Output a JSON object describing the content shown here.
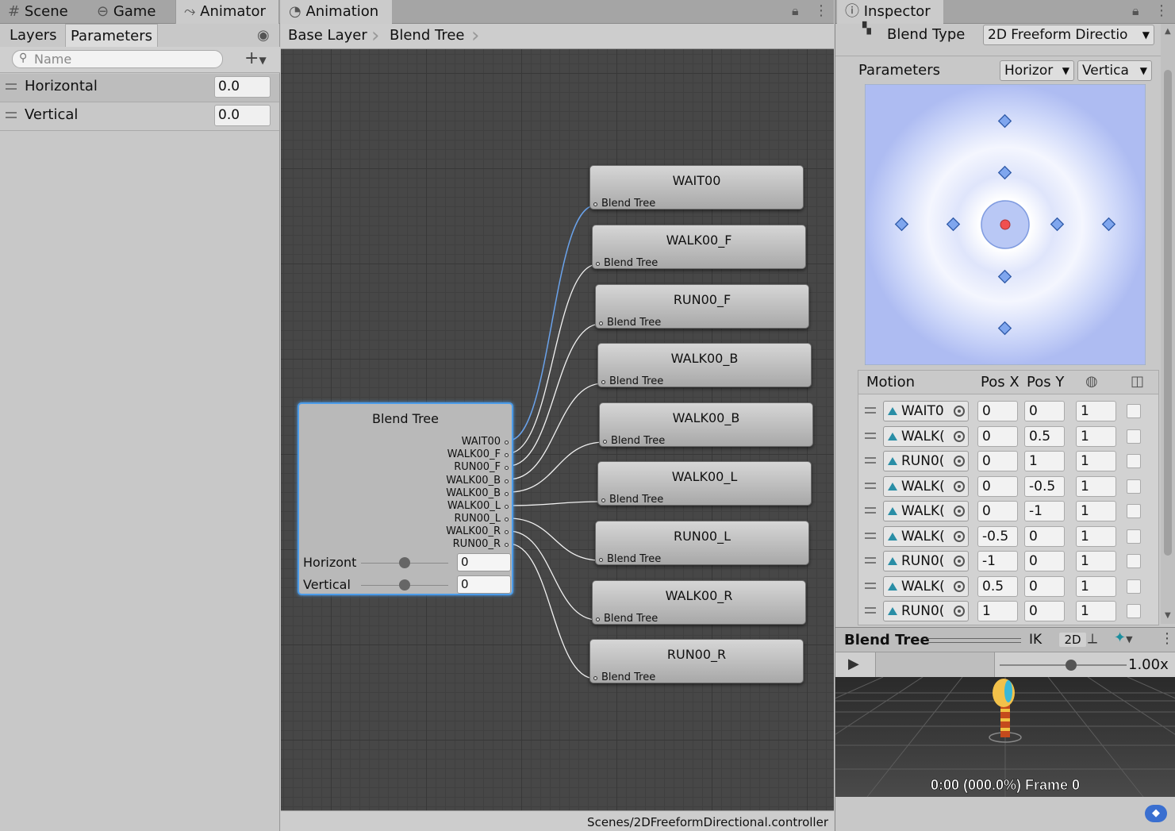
{
  "left_panel": {
    "tabs": [
      {
        "label": "Scene"
      },
      {
        "label": "Game"
      },
      {
        "label": "Animator"
      }
    ],
    "subtabs": {
      "layers": "Layers",
      "parameters": "Parameters"
    },
    "search_placeholder": "Name",
    "params": [
      {
        "name": "Horizontal",
        "value": "0.0"
      },
      {
        "name": "Vertical",
        "value": "0.0"
      }
    ]
  },
  "animation": {
    "tab": "Animation",
    "breadcrumb": [
      "Base Layer",
      "Blend Tree"
    ],
    "status_path": "Scenes/2DFreeformDirectional.controller",
    "blend_tree": {
      "title": "Blend Tree",
      "outputs": [
        "WAIT00",
        "WALK00_F",
        "RUN00_F",
        "WALK00_B",
        "WALK00_B",
        "WALK00_L",
        "RUN00_L",
        "WALK00_R",
        "RUN00_R"
      ],
      "params": [
        {
          "name": "Horizonta",
          "value": "0"
        },
        {
          "name": "Vertical",
          "value": "0"
        }
      ]
    },
    "nodes": [
      {
        "title": "WAIT00",
        "sub": "Blend Tree"
      },
      {
        "title": "WALK00_F",
        "sub": "Blend Tree"
      },
      {
        "title": "RUN00_F",
        "sub": "Blend Tree"
      },
      {
        "title": "WALK00_B",
        "sub": "Blend Tree"
      },
      {
        "title": "WALK00_B",
        "sub": "Blend Tree"
      },
      {
        "title": "WALK00_L",
        "sub": "Blend Tree"
      },
      {
        "title": "RUN00_L",
        "sub": "Blend Tree"
      },
      {
        "title": "WALK00_R",
        "sub": "Blend Tree"
      },
      {
        "title": "RUN00_R",
        "sub": "Blend Tree"
      }
    ]
  },
  "inspector": {
    "tab": "Inspector",
    "blend_type_label": "Blend Type",
    "blend_type_value": "2D Freeform Directio",
    "parameters_label": "Parameters",
    "param_x": "Horizor",
    "param_y": "Vertica",
    "table_headers": {
      "motion": "Motion",
      "posx": "Pos X",
      "posy": "Pos Y"
    },
    "rows": [
      {
        "motion": "WAIT0",
        "x": "0",
        "y": "0",
        "speed": "1"
      },
      {
        "motion": "WALK(",
        "x": "0",
        "y": "0.5",
        "speed": "1"
      },
      {
        "motion": "RUN0(",
        "x": "0",
        "y": "1",
        "speed": "1"
      },
      {
        "motion": "WALK(",
        "x": "0",
        "y": "-0.5",
        "speed": "1"
      },
      {
        "motion": "WALK(",
        "x": "0",
        "y": "-1",
        "speed": "1"
      },
      {
        "motion": "WALK(",
        "x": "-0.5",
        "y": "0",
        "speed": "1"
      },
      {
        "motion": "RUN0(",
        "x": "-1",
        "y": "0",
        "speed": "1"
      },
      {
        "motion": "WALK(",
        "x": "0.5",
        "y": "0",
        "speed": "1"
      },
      {
        "motion": "RUN0(",
        "x": "1",
        "y": "0",
        "speed": "1"
      }
    ],
    "preview": {
      "title": "Blend Tree",
      "ik": "IK",
      "two_d": "2D",
      "speed": "1.00x",
      "speed_fraction": 0.56,
      "frame_text": "0:00 (000.0%) Frame 0"
    }
  },
  "colors": {
    "accent": "#4b9be8",
    "graph_bg": "#474747",
    "panel": "#c8c8c8"
  }
}
